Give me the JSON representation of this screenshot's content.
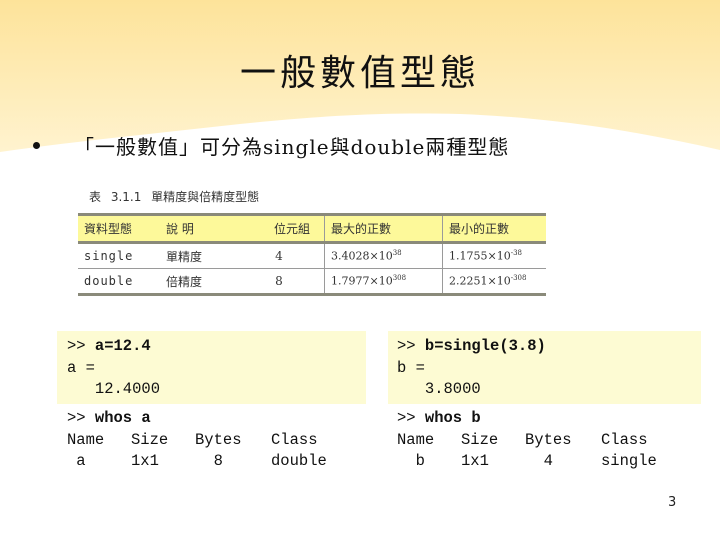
{
  "slide": {
    "title": "一般數值型態",
    "bullet": "「一般數值」可分為single與double兩種型態",
    "page_number": "3",
    "colors": {
      "band_top": "#fde39a",
      "band_bottom": "#fff1c8",
      "table_header": "#fdf99a",
      "code_bg": "#fdfbd3"
    }
  },
  "table": {
    "caption": "表 3.1.1  單精度與倍精度型態",
    "headers": [
      "資料型態",
      "說 明",
      "位元組",
      "最大的正數",
      "最小的正數"
    ],
    "rows": [
      {
        "type": "single",
        "desc": "單精度",
        "bytes": "4",
        "max_mant": "3.4028",
        "max_exp": "38",
        "min_mant": "1.1755",
        "min_exp": "-38"
      },
      {
        "type": "double",
        "desc": "倍精度",
        "bytes": "8",
        "max_mant": "1.7977",
        "max_exp": "308",
        "min_mant": "2.2251",
        "min_exp": "-308"
      }
    ],
    "times_ten": "×10"
  },
  "code_left": {
    "prompt": ">> ",
    "command": "a=12.4",
    "output_line1": "a =",
    "output_line2": "   12.4000",
    "whos_prompt": ">> ",
    "whos_command": "whos a",
    "whos_headers": [
      "Name",
      "Size",
      "Bytes",
      "Class"
    ],
    "whos_row": [
      " a",
      "1x1",
      "  8",
      "double"
    ]
  },
  "code_right": {
    "prompt": ">> ",
    "command": "b=single(3.8)",
    "output_line1": "b =",
    "output_line2": "   3.8000",
    "whos_prompt": ">> ",
    "whos_command": "whos b",
    "whos_headers": [
      "Name",
      "Size",
      "Bytes",
      "Class"
    ],
    "whos_row": [
      "  b",
      "1x1",
      "  4",
      "single"
    ]
  }
}
